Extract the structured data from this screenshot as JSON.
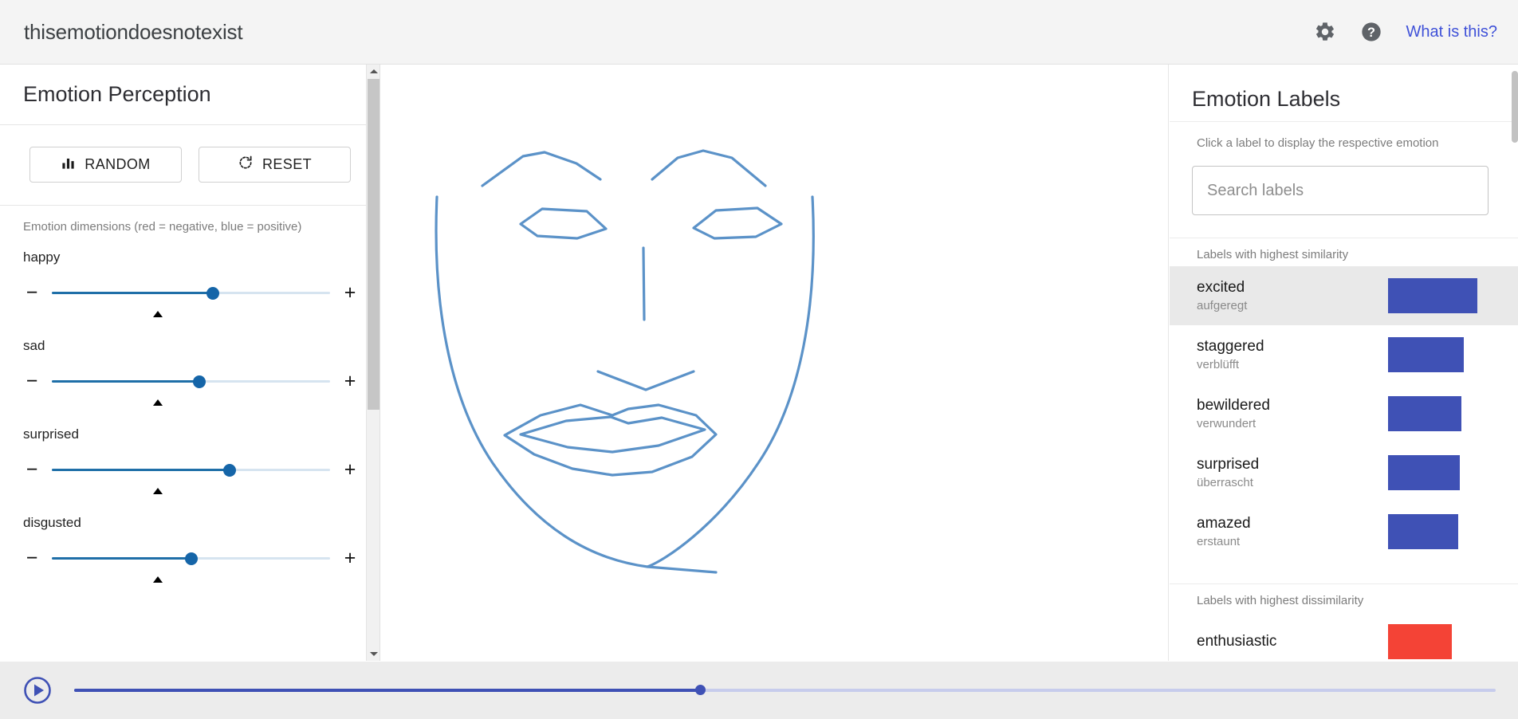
{
  "header": {
    "app_title": "thisemotiondoesnotexist",
    "settings_icon": "gear-icon",
    "help_icon": "help-circle-icon",
    "what_is_this": "What is this?",
    "link_color": "#3f51d8"
  },
  "left_panel": {
    "title": "Emotion Perception",
    "random_button": "RANDOM",
    "random_icon": "bar-chart-icon",
    "reset_button": "RESET",
    "reset_icon": "rotate-ccw-icon",
    "dimensions_caption": "Emotion dimensions (red = negative, blue = positive)",
    "minus_label": "−",
    "plus_label": "+",
    "sliders": [
      {
        "name": "happy",
        "value": 58,
        "tick": 38
      },
      {
        "name": "sad",
        "value": 53,
        "tick": 38
      },
      {
        "name": "surprised",
        "value": 64,
        "tick": 38
      },
      {
        "name": "disgusted",
        "value": 50,
        "tick": 38
      }
    ]
  },
  "canvas": {
    "name": "emotion-face-drawing",
    "stroke_color": "#5b92c8",
    "background": "#ffffff"
  },
  "right_panel": {
    "title": "Emotion Labels",
    "hint": "Click a label to display the respective emotion",
    "search_placeholder": "Search labels",
    "search_value": "",
    "similar_caption": "Labels with highest similarity",
    "dissimilar_caption": "Labels with highest dissimilarity",
    "positive_color": "#3f51b5",
    "negative_color": "#f44336",
    "similar_labels": [
      {
        "en": "excited",
        "de": "aufgeregt",
        "bar": 112,
        "selected": true
      },
      {
        "en": "staggered",
        "de": "verblüfft",
        "bar": 95,
        "selected": false
      },
      {
        "en": "bewildered",
        "de": "verwundert",
        "bar": 92,
        "selected": false
      },
      {
        "en": "surprised",
        "de": "überrascht",
        "bar": 90,
        "selected": false
      },
      {
        "en": "amazed",
        "de": "erstaunt",
        "bar": 88,
        "selected": false
      }
    ],
    "dissimilar_labels": [
      {
        "en": "enthusiastic",
        "de": "",
        "bar": 80,
        "selected": false
      }
    ]
  },
  "bottom_bar": {
    "play_icon": "play-circle-icon",
    "timeline_value": 44
  }
}
